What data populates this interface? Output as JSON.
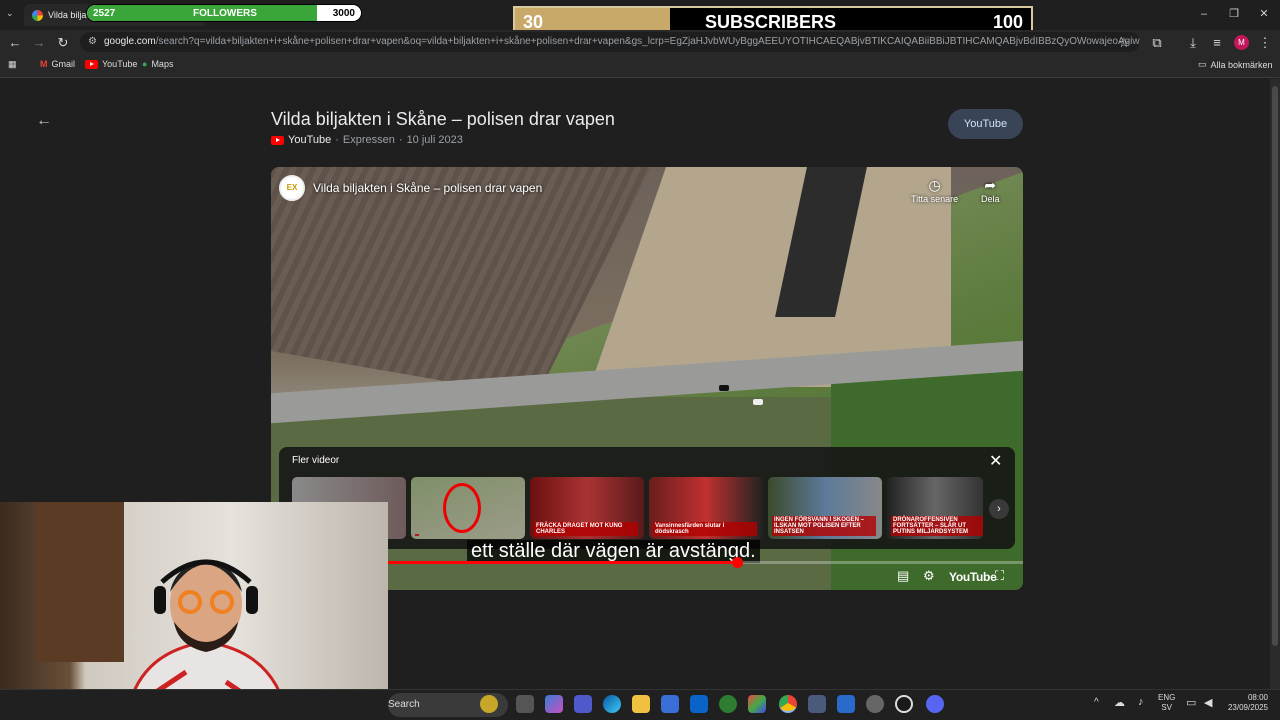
{
  "browser": {
    "tab_title": "Vilda biljak",
    "url_host": "google.com",
    "url_rest": "/search?q=vilda+biljakten+i+skåne+polisen+drar+vapen&oq=vilda+biljakten+i+skåne+polisen+drar+vapen&gs_lcrp=EgZjaHJvbWUyBggAEEUYOTIHCAEQABjvBTIKCAIQABiiBBiJBTIHCAMQABjvBdIBBzQyOWowajeoAgiwAgHxBdioX...",
    "bookmarks": [
      "Gmail",
      "YouTube",
      "Maps"
    ],
    "all_bookmarks": "Alla bokmärken",
    "profile_initial": "M"
  },
  "overlay": {
    "followers_current": "2527",
    "followers_label": "FOLLOWERS",
    "followers_goal": "3000",
    "followers_progress": 0.84,
    "subs_current": "30",
    "subs_label": "SUBSCRIBERS",
    "subs_goal": "100",
    "subs_progress": 0.3
  },
  "result": {
    "title": "Vilda biljakten i Skåne – polisen drar vapen",
    "source": "YouTube",
    "channel": "Expressen",
    "date": "10 juli 2023",
    "source_button": "YouTube"
  },
  "player": {
    "title": "Vilda biljakten i Skåne – polisen drar vapen",
    "watch_later": "Titta senare",
    "share": "Dela",
    "more_videos_label": "Fler videor",
    "thumbnails": [
      {
        "caption": ""
      },
      {
        "caption": ""
      },
      {
        "caption": "FRÄCKA DRAGET MOT KUNG CHARLES"
      },
      {
        "caption": "Vansinnesfärden slutar i dödskrasch"
      },
      {
        "caption": "INGEN FÖRSVANN I SKOGEN – ILSKAN MOT POLISEN EFTER INSATSEN"
      },
      {
        "caption": "DRÖNAROFFENSIVEN FORTSÄTTER – SLÅR UT PUTINS MILJARDSYSTEM"
      }
    ],
    "subtitle": "ett ställe där vägen är avstängd.",
    "progress": 0.62,
    "logo": "YouTube"
  },
  "taskbar": {
    "search_label": "Search",
    "lang_top": "ENG",
    "lang_bottom": "SV",
    "time": "08:00",
    "date": "23/09/2025"
  }
}
